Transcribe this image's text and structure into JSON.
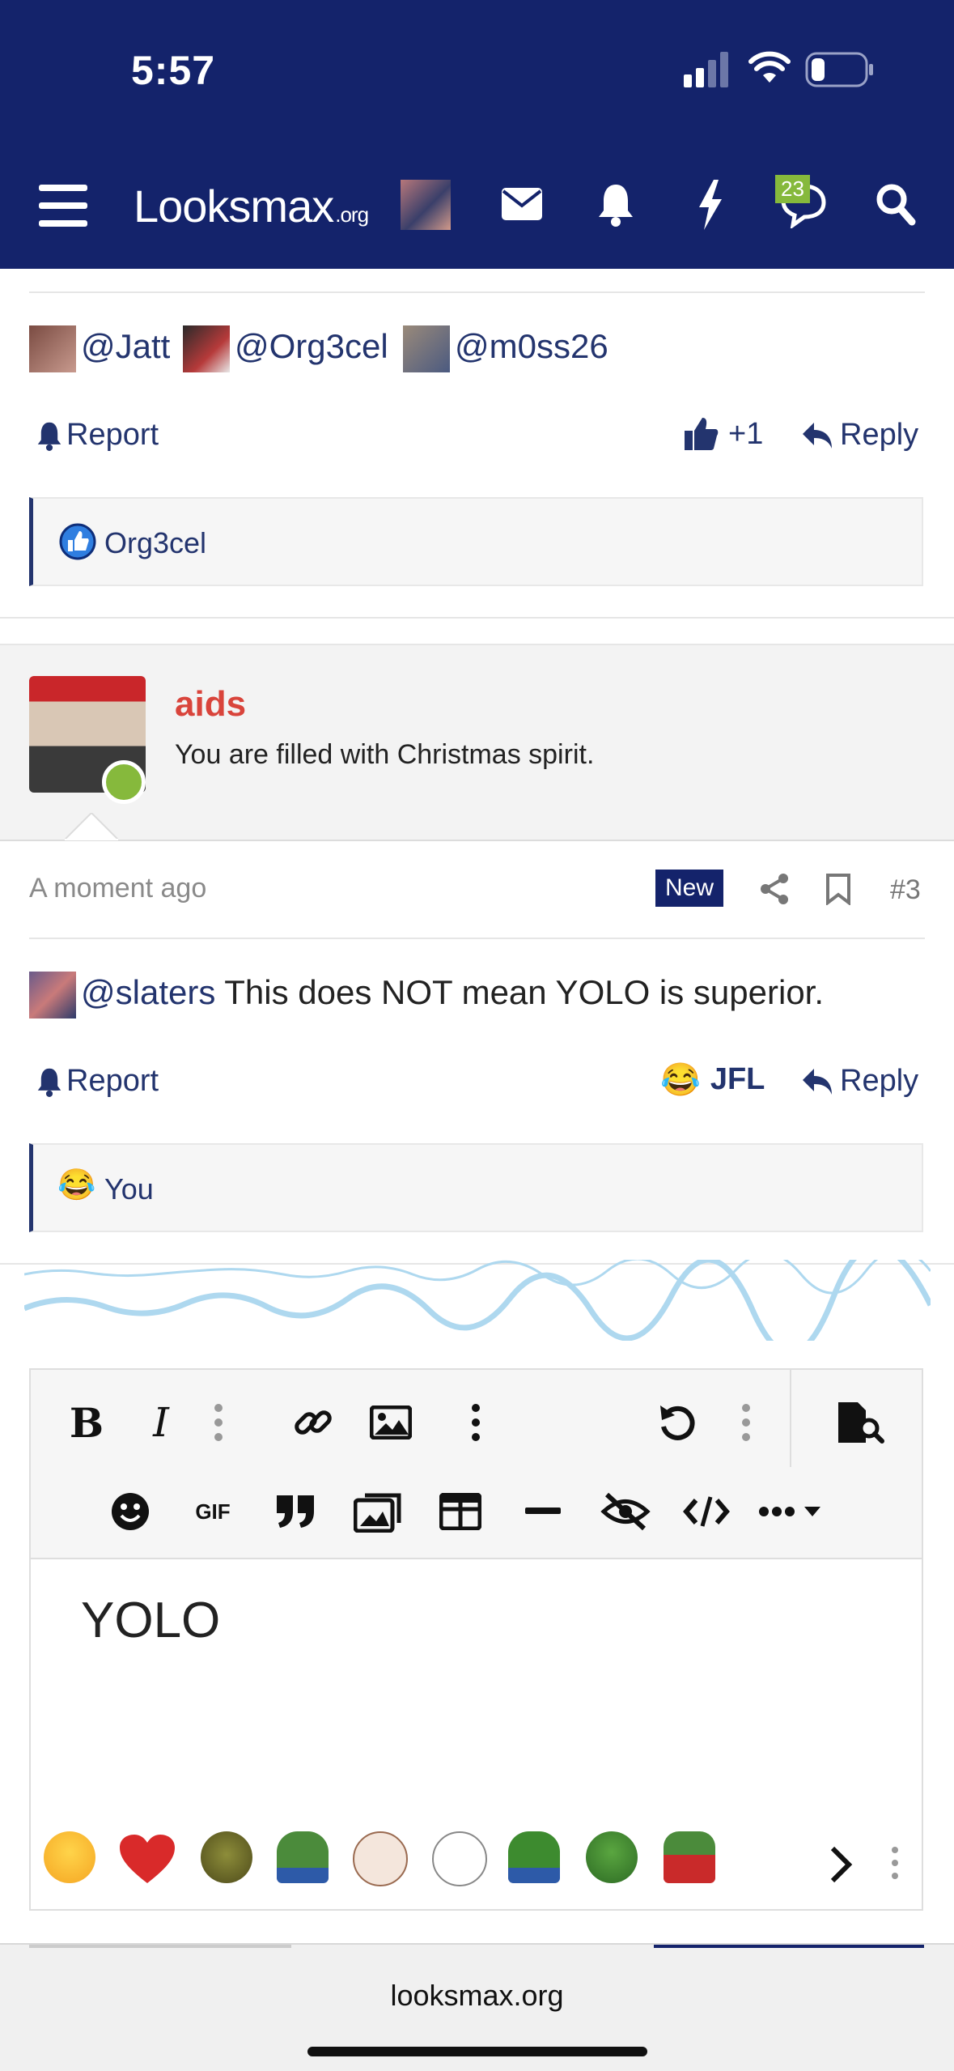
{
  "status_bar": {
    "time": "5:57"
  },
  "nav": {
    "logo_main": "Looksmax",
    "logo_suffix": ".org",
    "chat_badge": "23",
    "icons": [
      "menu-icon",
      "avatar",
      "mail-icon",
      "bell-icon",
      "lightning-icon",
      "chat-icon",
      "search-icon"
    ]
  },
  "post1": {
    "mentions": [
      "@Jatt",
      "@Org3cel",
      "@m0ss26"
    ],
    "report_label": "Report",
    "like_count": "+1",
    "reply_label": "Reply",
    "reaction_user": "Org3cel"
  },
  "post2": {
    "username": "aids",
    "user_title": "You are filled with Christmas spirit.",
    "time": "A moment ago",
    "new_badge": "New",
    "post_number": "#3",
    "mention": "@slaters",
    "body": " This does NOT mean YOLO is superior.",
    "report_label": "Report",
    "reaction_label": "JFL",
    "reply_label": "Reply",
    "reaction_user": "You"
  },
  "editor": {
    "content": "YOLO",
    "toolbar_row1": [
      "bold",
      "italic",
      "more",
      "link",
      "image",
      "more",
      "undo",
      "more",
      "preview"
    ],
    "toolbar_row2": [
      "smiley",
      "gif",
      "quote",
      "media",
      "table",
      "hr",
      "spoiler",
      "code",
      "more-dropdown"
    ],
    "gif_label": "GIF"
  },
  "emoji_bar": [
    "joy-emoji",
    "heart-emoji",
    "shrek-emoji",
    "pepe-emoji",
    "wojak-emoji",
    "crying-wojak-emoji",
    "pepe-grin-emoji",
    "pepe-laugh-emoji",
    "pepe-santa-emoji"
  ],
  "browser": {
    "url": "looksmax.org"
  },
  "colors": {
    "nav_bg": "#14236b",
    "link": "#23346e",
    "username": "#d9443b",
    "online": "#86b93c"
  }
}
